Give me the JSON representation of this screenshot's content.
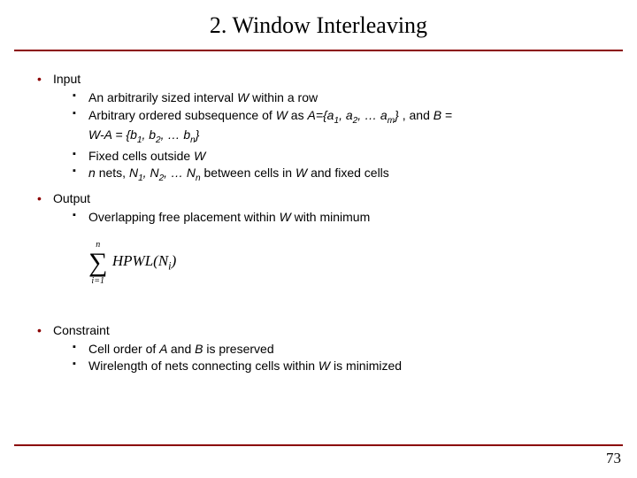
{
  "title": "2. Window Interleaving",
  "sections": {
    "input": {
      "label": "Input",
      "items": [
        {
          "pre": "An arbitrarily sized interval ",
          "i1": "W ",
          "post": "within a row"
        },
        {
          "pre": "Arbitrary ordered subsequence of ",
          "i1": "W ",
          "mid1": "as ",
          "seq": "A={a",
          "s1": "1",
          "c1": ", a",
          "s2": "2",
          "c2": ", … a",
          "s3": "m",
          "close": "}",
          "tail": " , and ",
          "i2": "B",
          "eq": " = ",
          "line2a": "W-A = {b",
          "l2s1": "1",
          "l2c1": ", b",
          "l2s2": "2",
          "l2c2": ", … b",
          "l2s3": "n",
          "l2close": "}"
        },
        {
          "pre": "Fixed cells outside ",
          "i1": "W"
        },
        {
          "i0": "n ",
          "mid0": "nets, ",
          "i1": "N",
          "s1": "1",
          "c1": ", N",
          "s2": "2",
          "c2": ", … N",
          "s3": "n",
          "mid1": " between cells in ",
          "i2": "W ",
          "post": "and fixed cells"
        }
      ]
    },
    "output": {
      "label": "Output",
      "items": [
        {
          "pre": "Overlapping free placement within ",
          "i1": "W ",
          "post": "with minimum"
        }
      ]
    },
    "formula": {
      "upper": "n",
      "lower": "i=1",
      "body": "HPWL(N",
      "sub": "i",
      "close": ")"
    },
    "constraint": {
      "label": "Constraint",
      "items": [
        {
          "pre": "Cell order of ",
          "i1": "A ",
          "mid1": "and ",
          "i2": "B ",
          "post": "is preserved"
        },
        {
          "pre": "Wirelength of nets connecting cells within ",
          "i1": "W ",
          "post": "is minimized"
        }
      ]
    }
  },
  "page": "73"
}
